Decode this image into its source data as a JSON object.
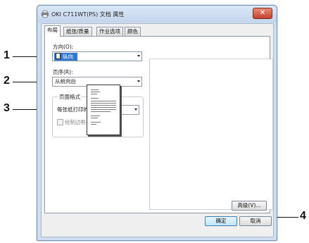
{
  "window": {
    "title": "OKI C711WT(PS) 文档 属性",
    "close_label": "✕"
  },
  "tabs": [
    {
      "label": "布局",
      "active": true
    },
    {
      "label": "纸张/质量",
      "active": false
    },
    {
      "label": "作业选项",
      "active": false
    },
    {
      "label": "颜色",
      "active": false
    }
  ],
  "layout": {
    "orientation_label": "方向(O):",
    "orientation_value": "纵向",
    "page_order_label": "页序(R):",
    "page_order_value": "从前向后",
    "page_format_group": "页面格式",
    "pages_per_sheet_label": "每张纸打印的页数(S)",
    "pages_per_sheet_value": "1",
    "draw_borders_label": "绘制边框(W)",
    "draw_borders_checked": false,
    "advanced_button": "高级(V)..."
  },
  "footer": {
    "ok_button": "确定",
    "cancel_button": "取消"
  },
  "callouts": [
    "1",
    "2",
    "3",
    "4"
  ]
}
